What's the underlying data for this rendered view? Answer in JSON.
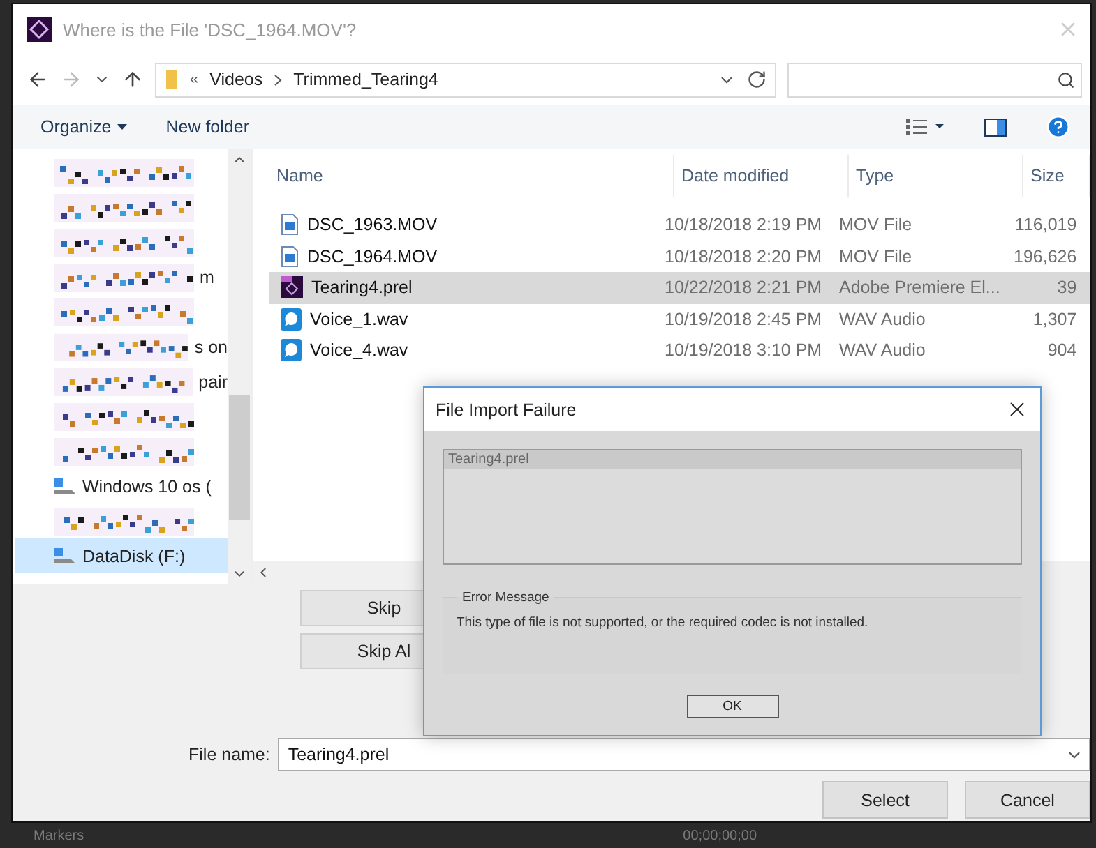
{
  "window": {
    "title": "Where is the File 'DSC_1964.MOV'?"
  },
  "address": {
    "overflow": "«",
    "path": [
      "Videos",
      "Trimmed_Tearing4"
    ]
  },
  "toolbar": {
    "organize": "Organize",
    "new_folder": "New folder"
  },
  "sidebar": {
    "items": [
      {
        "kind": "redacted",
        "selected": false
      },
      {
        "kind": "redacted",
        "selected": false
      },
      {
        "kind": "redacted",
        "selected": false
      },
      {
        "kind": "redacted",
        "tail": "m",
        "selected": false
      },
      {
        "kind": "redacted",
        "selected": false
      },
      {
        "kind": "redacted",
        "tail": "s on",
        "selected": false
      },
      {
        "kind": "redacted",
        "tail": "pair",
        "selected": false
      },
      {
        "kind": "redacted",
        "selected": false
      },
      {
        "kind": "redacted",
        "selected": false
      },
      {
        "kind": "drive",
        "label": "Windows 10 os (",
        "selected": false
      },
      {
        "kind": "redacted",
        "selected": false
      },
      {
        "kind": "drive",
        "label": "DataDisk (F:)",
        "selected": true
      }
    ]
  },
  "table": {
    "columns": [
      "Name",
      "Date modified",
      "Type",
      "Size"
    ],
    "rows": [
      {
        "kind": "video",
        "name": "DSC_1963.MOV",
        "date": "10/18/2018 2:19 PM",
        "type": "MOV File",
        "size": "116,019",
        "selected": false
      },
      {
        "kind": "video",
        "name": "DSC_1964.MOV",
        "date": "10/18/2018 2:20 PM",
        "type": "MOV File",
        "size": "196,626",
        "selected": false
      },
      {
        "kind": "premiere",
        "name": "Tearing4.prel",
        "date": "10/22/2018 2:21 PM",
        "type": "Adobe Premiere El...",
        "size": "39",
        "selected": true
      },
      {
        "kind": "audio",
        "name": "Voice_1.wav",
        "date": "10/19/2018 2:45 PM",
        "type": "WAV Audio",
        "size": "1,307",
        "selected": false
      },
      {
        "kind": "audio",
        "name": "Voice_4.wav",
        "date": "10/19/2018 3:10 PM",
        "type": "WAV Audio",
        "size": "904",
        "selected": false
      }
    ]
  },
  "skip_buttons": [
    "Skip",
    "Skip Al"
  ],
  "file_name": {
    "label": "File name:",
    "value": "Tearing4.prel"
  },
  "buttons": [
    "Select",
    "Cancel"
  ],
  "background_app": {
    "panel": "Markers",
    "timecode": "00;00;00;00"
  },
  "dialog": {
    "title": "File Import Failure",
    "list_header": "Tearing4.prel",
    "group": "Error Message",
    "message": "This type of file is not supported, or the required codec is not installed.",
    "ok": "OK"
  }
}
